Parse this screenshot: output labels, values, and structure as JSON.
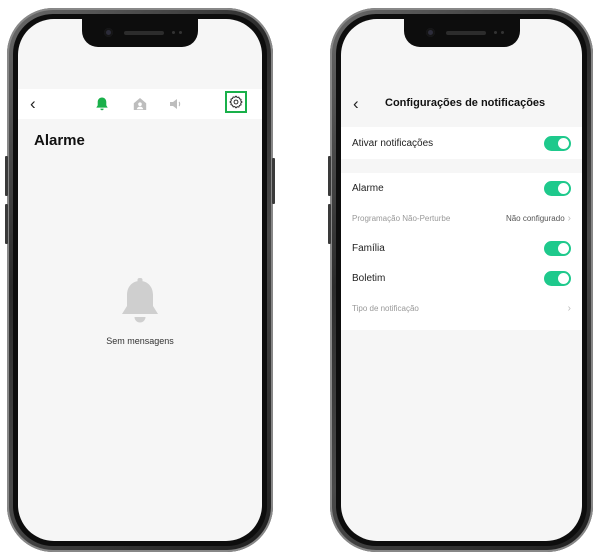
{
  "left_screen": {
    "back_icon": "chevron-left-icon",
    "tabs": [
      {
        "icon": "bell-icon",
        "color": "#19b04a"
      },
      {
        "icon": "home-person-icon",
        "color": "#bdbdbd"
      },
      {
        "icon": "speaker-icon",
        "color": "#bdbdbd"
      }
    ],
    "settings_icon": "gear-icon",
    "highlight_color": "#19b04a",
    "title": "Alarme",
    "empty_icon": "bell-icon",
    "empty_text": "Sem mensagens"
  },
  "right_screen": {
    "back_icon": "chevron-left-icon",
    "title": "Configurações de notificações",
    "toggle_color": "#1ec98c",
    "rows": {
      "enable": {
        "label": "Ativar notificações",
        "on": true
      },
      "alarm": {
        "label": "Alarme",
        "on": true
      },
      "dnd": {
        "label": "Programação Não-Perturbe",
        "value": "Não configurado"
      },
      "family": {
        "label": "Família",
        "on": true
      },
      "bulletin": {
        "label": "Boletim",
        "on": true
      },
      "type": {
        "label": "Tipo de notificação"
      }
    }
  }
}
